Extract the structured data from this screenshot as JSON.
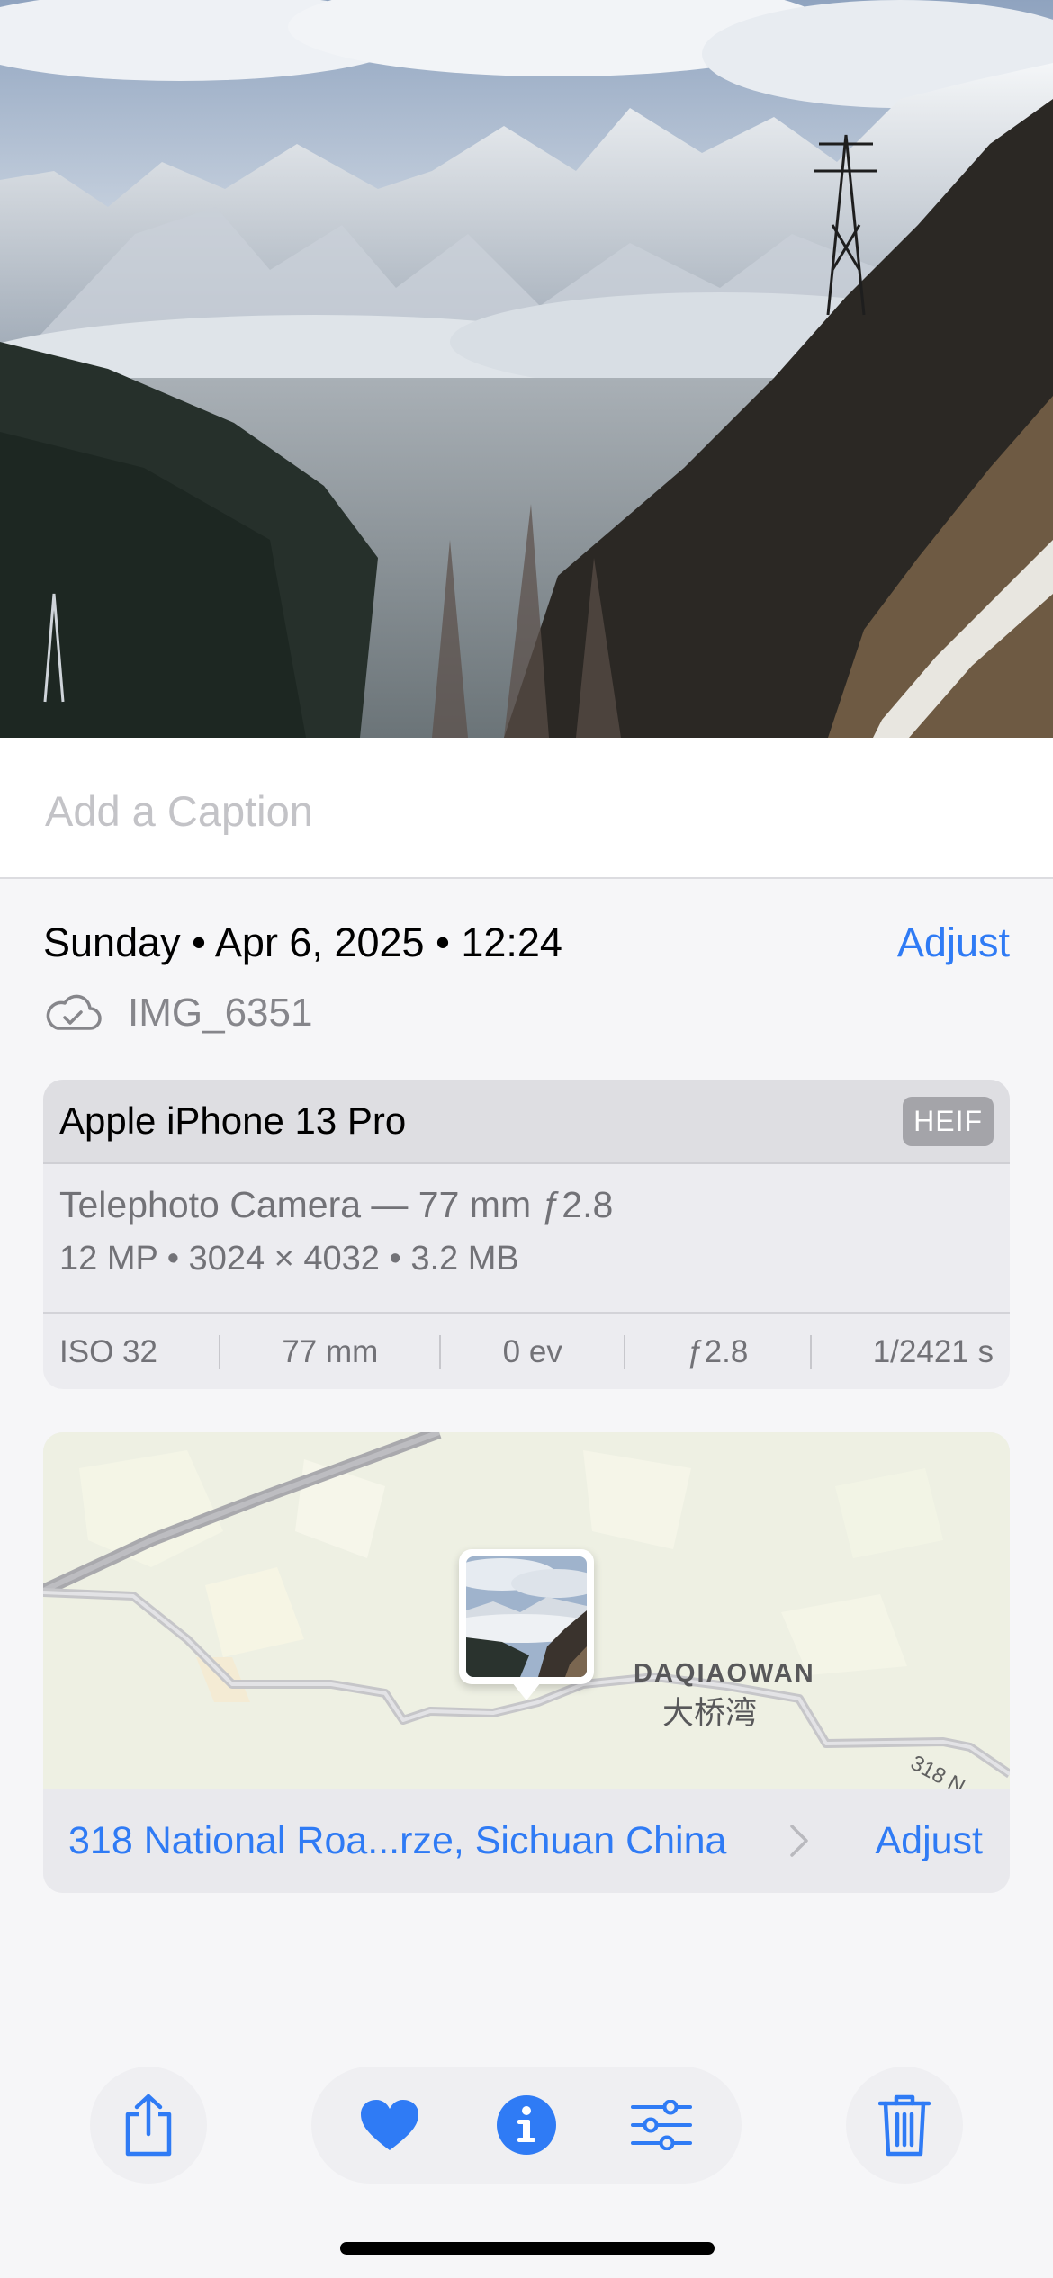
{
  "caption": {
    "placeholder": "Add a Caption"
  },
  "datetime": {
    "text": "Sunday • Apr 6, 2025 • 12:24",
    "adjust_label": "Adjust"
  },
  "file": {
    "name": "IMG_6351",
    "icon": "icloud-icon"
  },
  "camera": {
    "model": "Apple iPhone 13 Pro",
    "format": "HEIF",
    "lens": "Telephoto Camera — 77 mm ƒ2.8",
    "specs": "12 MP • 3024 × 4032 • 3.2 MB",
    "stats": {
      "iso": "ISO 32",
      "focal": "77 mm",
      "ev": "0 ev",
      "aperture": "ƒ2.8",
      "shutter": "1/2421 s"
    }
  },
  "map": {
    "place_en": "DAQIAOWAN",
    "place_zh": "大桥湾",
    "road_label": "318 N",
    "address": "318 National Roa...rze, Sichuan China",
    "adjust_label": "Adjust"
  },
  "toolbar": {
    "share_icon": "share-icon",
    "favorite_icon": "heart-icon",
    "info_icon": "info-icon",
    "edit_icon": "sliders-icon",
    "delete_icon": "trash-icon"
  },
  "colors": {
    "accent": "#2f7bf5",
    "secondary_text": "#86868b"
  }
}
